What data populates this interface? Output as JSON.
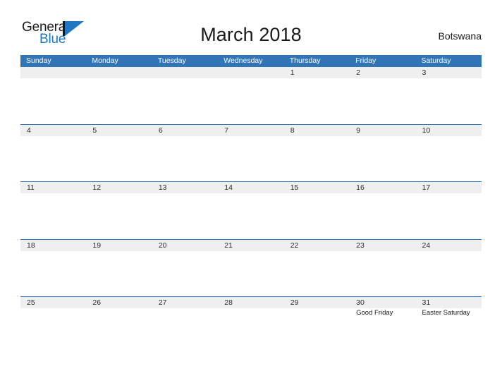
{
  "brand": {
    "word_one": "General",
    "word_two": "Blue",
    "flag_icon": "flag-triangle-icon",
    "accent_color": "#1f76c2"
  },
  "header": {
    "title": "March 2018",
    "country": "Botswana"
  },
  "theme": {
    "header_blue": "#3275b7",
    "date_band_gray": "#efefef",
    "separator_blue": "#3275b7",
    "text_dark": "#1a1a1a"
  },
  "calendar": {
    "weekday_headers": [
      "Sunday",
      "Monday",
      "Tuesday",
      "Wednesday",
      "Thursday",
      "Friday",
      "Saturday"
    ],
    "weeks": [
      [
        {
          "day": "",
          "event": ""
        },
        {
          "day": "",
          "event": ""
        },
        {
          "day": "",
          "event": ""
        },
        {
          "day": "",
          "event": ""
        },
        {
          "day": "1",
          "event": ""
        },
        {
          "day": "2",
          "event": ""
        },
        {
          "day": "3",
          "event": ""
        }
      ],
      [
        {
          "day": "4",
          "event": ""
        },
        {
          "day": "5",
          "event": ""
        },
        {
          "day": "6",
          "event": ""
        },
        {
          "day": "7",
          "event": ""
        },
        {
          "day": "8",
          "event": ""
        },
        {
          "day": "9",
          "event": ""
        },
        {
          "day": "10",
          "event": ""
        }
      ],
      [
        {
          "day": "11",
          "event": ""
        },
        {
          "day": "12",
          "event": ""
        },
        {
          "day": "13",
          "event": ""
        },
        {
          "day": "14",
          "event": ""
        },
        {
          "day": "15",
          "event": ""
        },
        {
          "day": "16",
          "event": ""
        },
        {
          "day": "17",
          "event": ""
        }
      ],
      [
        {
          "day": "18",
          "event": ""
        },
        {
          "day": "19",
          "event": ""
        },
        {
          "day": "20",
          "event": ""
        },
        {
          "day": "21",
          "event": ""
        },
        {
          "day": "22",
          "event": ""
        },
        {
          "day": "23",
          "event": ""
        },
        {
          "day": "24",
          "event": ""
        }
      ],
      [
        {
          "day": "25",
          "event": ""
        },
        {
          "day": "26",
          "event": ""
        },
        {
          "day": "27",
          "event": ""
        },
        {
          "day": "28",
          "event": ""
        },
        {
          "day": "29",
          "event": ""
        },
        {
          "day": "30",
          "event": "Good Friday"
        },
        {
          "day": "31",
          "event": "Easter Saturday"
        }
      ]
    ]
  }
}
